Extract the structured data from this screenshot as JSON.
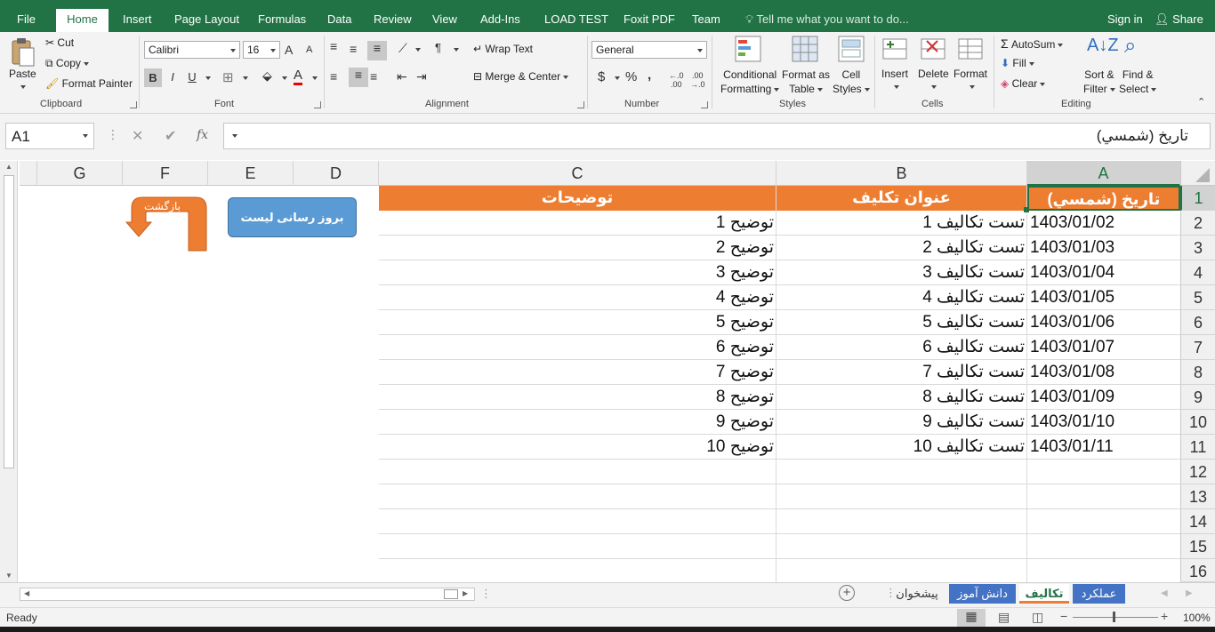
{
  "tabs": [
    {
      "label": "File",
      "active": false
    },
    {
      "label": "Home",
      "active": true
    },
    {
      "label": "Insert",
      "active": false
    },
    {
      "label": "Page Layout",
      "active": false
    },
    {
      "label": "Formulas",
      "active": false
    },
    {
      "label": "Data",
      "active": false
    },
    {
      "label": "Review",
      "active": false
    },
    {
      "label": "View",
      "active": false
    },
    {
      "label": "Add-Ins",
      "active": false
    },
    {
      "label": "LOAD TEST",
      "active": false
    },
    {
      "label": "Foxit PDF",
      "active": false
    },
    {
      "label": "Team",
      "active": false
    }
  ],
  "tell_me": "Tell me what you want to do...",
  "sign_in": "Sign in",
  "share": "Share",
  "clipboard": {
    "paste": "Paste",
    "cut": "Cut",
    "copy": "Copy",
    "format_painter": "Format Painter",
    "label": "Clipboard"
  },
  "font": {
    "name": "Calibri",
    "size": "16",
    "bold": "B",
    "italic": "I",
    "underline": "U",
    "grow": "A",
    "shrink": "A",
    "label": "Font"
  },
  "alignment": {
    "wrap_text": "Wrap Text",
    "merge_center": "Merge & Center",
    "label": "Alignment"
  },
  "number": {
    "format": "General",
    "currency": "$",
    "percent": "%",
    "comma": ",",
    "label": "Number"
  },
  "styles": {
    "conditional": "Conditional",
    "conditional2": "Formatting",
    "format_as": "Format as",
    "format_as2": "Table",
    "cell": "Cell",
    "cell2": "Styles",
    "label": "Styles"
  },
  "cells": {
    "insert": "Insert",
    "delete": "Delete",
    "format": "Format",
    "label": "Cells"
  },
  "editing": {
    "autosum": "AutoSum",
    "fill": "Fill",
    "clear": "Clear",
    "sort": "Sort &",
    "sort2": "Filter",
    "find": "Find &",
    "find2": "Select",
    "label": "Editing"
  },
  "formula_bar": {
    "name_box": "A1",
    "fx": "fx",
    "content": "تاريخ (شمسي)"
  },
  "columns": [
    "G",
    "F",
    "E",
    "D",
    "C",
    "B",
    "A"
  ],
  "rows": [
    "1",
    "2",
    "3",
    "4",
    "5",
    "6",
    "7",
    "8",
    "9",
    "10",
    "11",
    "12",
    "13",
    "14",
    "15",
    "16"
  ],
  "table": {
    "headers": {
      "a": "تاريخ (شمسي)",
      "b": "عنوان تكليف",
      "c": "توضيحات"
    },
    "data": [
      {
        "a": "1403/01/02",
        "b": "تست تكاليف 1",
        "c": "توضیح 1"
      },
      {
        "a": "1403/01/03",
        "b": "تست تكاليف 2",
        "c": "توضیح 2"
      },
      {
        "a": "1403/01/04",
        "b": "تست تكاليف 3",
        "c": "توضیح 3"
      },
      {
        "a": "1403/01/05",
        "b": "تست تكاليف 4",
        "c": "توضیح 4"
      },
      {
        "a": "1403/01/06",
        "b": "تست تكاليف 5",
        "c": "توضیح 5"
      },
      {
        "a": "1403/01/07",
        "b": "تست تكاليف 6",
        "c": "توضیح 6"
      },
      {
        "a": "1403/01/08",
        "b": "تست تكاليف 7",
        "c": "توضیح 7"
      },
      {
        "a": "1403/01/09",
        "b": "تست تكاليف 8",
        "c": "توضیح 8"
      },
      {
        "a": "1403/01/10",
        "b": "تست تكاليف 9",
        "c": "توضیح 9"
      },
      {
        "a": "1403/01/11",
        "b": "تست تكاليف 10",
        "c": "توضیح 10"
      }
    ]
  },
  "buttons": {
    "refresh": "بروز رسانی لیست",
    "back": "بازگشت"
  },
  "sheets": [
    {
      "label": "عملکرد",
      "active": false,
      "color": "#4472c4"
    },
    {
      "label": "تکالیف",
      "active": true,
      "color": "#ed7d31"
    },
    {
      "label": "دانش آموز",
      "active": false,
      "color": "#4472c4"
    },
    {
      "label": "پیشخوان",
      "active": false,
      "color": ""
    }
  ],
  "status": {
    "ready": "Ready",
    "zoom": "100%"
  },
  "colors": {
    "brand": "#217346",
    "header_fill": "#ed7d31",
    "button_blue": "#5b9bd5"
  }
}
